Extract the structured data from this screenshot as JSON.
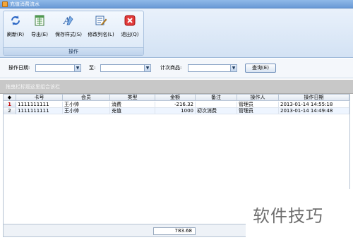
{
  "window": {
    "title": "充值消费流水"
  },
  "ribbon": {
    "group_label": "操作",
    "tools": [
      {
        "label": "刷新(R)",
        "icon": "refresh-icon"
      },
      {
        "label": "导出(E)",
        "icon": "export-icon"
      },
      {
        "label": "保存样式(S)",
        "icon": "save-style-icon"
      },
      {
        "label": "修改列名(L)",
        "icon": "edit-columns-icon"
      },
      {
        "label": "退出(Q)",
        "icon": "exit-icon"
      }
    ]
  },
  "filter": {
    "date_label": "操作日期:",
    "to_label": "至:",
    "product_label": "计次商品:",
    "date_from": "",
    "date_to": "",
    "product": "",
    "query_label": "查询(E)"
  },
  "group_hint": "拖曳栏标题这里组合该栏",
  "table": {
    "columns": [
      "卡号",
      "会员",
      "类型",
      "金额",
      "备注",
      "操作人",
      "操作日期"
    ],
    "rows": [
      {
        "no": "1",
        "card": "1111111111",
        "member": "王小帅",
        "type": "消费",
        "amount": "-216.32",
        "note": "",
        "operator": "管理员",
        "date": "2013-01-14 14:55:18"
      },
      {
        "no": "2",
        "card": "1111111111",
        "member": "王小帅",
        "type": "充值",
        "amount": "1000",
        "note": "初次消费",
        "operator": "管理员",
        "date": "2013-01-14 14:49:48"
      }
    ]
  },
  "footer": {
    "total": "783.68"
  },
  "watermark": "软件技巧",
  "colors": {
    "titlebar": "#6a9ad6",
    "ribbon": "#d3e2f4",
    "selected_row_number": "#c00000",
    "group_bar": "#c8c8c8"
  }
}
